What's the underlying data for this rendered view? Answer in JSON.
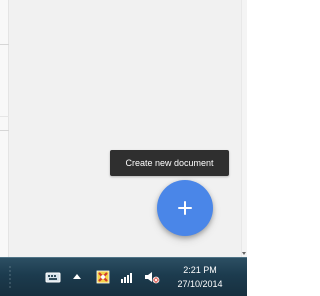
{
  "tooltip": {
    "text": "Create new document"
  },
  "fab": {
    "icon": "plus-icon",
    "color": "#4a86e8"
  },
  "taskbar": {
    "time": "2:21 PM",
    "date": "27/10/2014",
    "icons": [
      "keyboard-icon",
      "show-hidden-icons-arrow",
      "security-alert-icon",
      "network-signal-icon",
      "volume-muted-icon"
    ],
    "accent": "#1c3b4e"
  }
}
